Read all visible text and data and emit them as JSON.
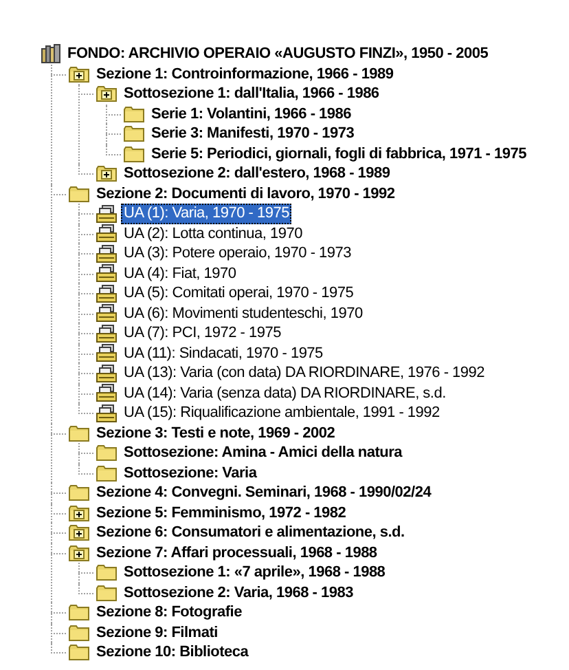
{
  "tree": {
    "label": "FONDO: ARCHIVIO OPERAIO «AUGUSTO FINZI», 1950 - 2005",
    "kind": "fonds",
    "selected": false,
    "children": [
      {
        "label": "Sezione 1: Controinformazione, 1966 - 1989",
        "kind": "folder-plus",
        "selected": false,
        "children": [
          {
            "label": "Sottosezione 1: dall'Italia, 1966 - 1986",
            "kind": "folder-plus",
            "selected": false,
            "children": [
              {
                "label": "Serie 1: Volantini, 1966 - 1986",
                "kind": "folder",
                "selected": false
              },
              {
                "label": "Serie 3: Manifesti, 1970 - 1973",
                "kind": "folder",
                "selected": false
              },
              {
                "label": "Serie 5: Periodici, giornali, fogli di fabbrica, 1971 - 1975",
                "kind": "folder",
                "selected": false
              }
            ]
          },
          {
            "label": "Sottosezione 2: dall'estero, 1968 - 1989",
            "kind": "folder-plus",
            "selected": false
          }
        ]
      },
      {
        "label": "Sezione 2: Documenti di lavoro, 1970 - 1992",
        "kind": "folder",
        "selected": false,
        "children": [
          {
            "label": "UA (1): Varia, 1970 - 1975",
            "kind": "unit",
            "selected": true
          },
          {
            "label": "UA (2): Lotta continua, 1970",
            "kind": "unit",
            "selected": false
          },
          {
            "label": "UA (3): Potere operaio, 1970 - 1973",
            "kind": "unit",
            "selected": false
          },
          {
            "label": "UA (4): Fiat, 1970",
            "kind": "unit",
            "selected": false
          },
          {
            "label": "UA (5): Comitati operai, 1970 - 1975",
            "kind": "unit",
            "selected": false
          },
          {
            "label": "UA (6): Movimenti studenteschi, 1970",
            "kind": "unit",
            "selected": false
          },
          {
            "label": "UA (7): PCI, 1972 - 1975",
            "kind": "unit",
            "selected": false
          },
          {
            "label": "UA (11): Sindacati, 1970 - 1975",
            "kind": "unit",
            "selected": false
          },
          {
            "label": "UA (13): Varia (con data) DA RIORDINARE, 1976 - 1992",
            "kind": "unit",
            "selected": false
          },
          {
            "label": "UA (14): Varia (senza data) DA RIORDINARE, s.d.",
            "kind": "unit",
            "selected": false
          },
          {
            "label": "UA (15): Riqualificazione ambientale, 1991 - 1992",
            "kind": "unit",
            "selected": false
          }
        ]
      },
      {
        "label": "Sezione 3: Testi e note, 1969 - 2002",
        "kind": "folder",
        "selected": false,
        "children": [
          {
            "label": "Sottosezione: Amina - Amici della natura",
            "kind": "folder",
            "selected": false
          },
          {
            "label": "Sottosezione: Varia",
            "kind": "folder",
            "selected": false
          }
        ]
      },
      {
        "label": "Sezione 4: Convegni. Seminari, 1968 - 1990/02/24",
        "kind": "folder",
        "selected": false
      },
      {
        "label": "Sezione 5: Femminismo, 1972 - 1982",
        "kind": "folder-plus",
        "selected": false
      },
      {
        "label": "Sezione 6: Consumatori e alimentazione, s.d.",
        "kind": "folder-plus",
        "selected": false
      },
      {
        "label": "Sezione 7: Affari processuali, 1968 - 1988",
        "kind": "folder-plus",
        "selected": false,
        "children": [
          {
            "label": "Sottosezione 1: «7 aprile», 1968 - 1988",
            "kind": "folder",
            "selected": false
          },
          {
            "label": "Sottosezione 2: Varia, 1968 - 1983",
            "kind": "folder",
            "selected": false
          }
        ]
      },
      {
        "label": "Sezione 8: Fotografie",
        "kind": "folder",
        "selected": false
      },
      {
        "label": "Sezione 9: Filmati",
        "kind": "folder",
        "selected": false
      },
      {
        "label": "Sezione 10: Biblioteca",
        "kind": "folder",
        "selected": false
      }
    ]
  }
}
